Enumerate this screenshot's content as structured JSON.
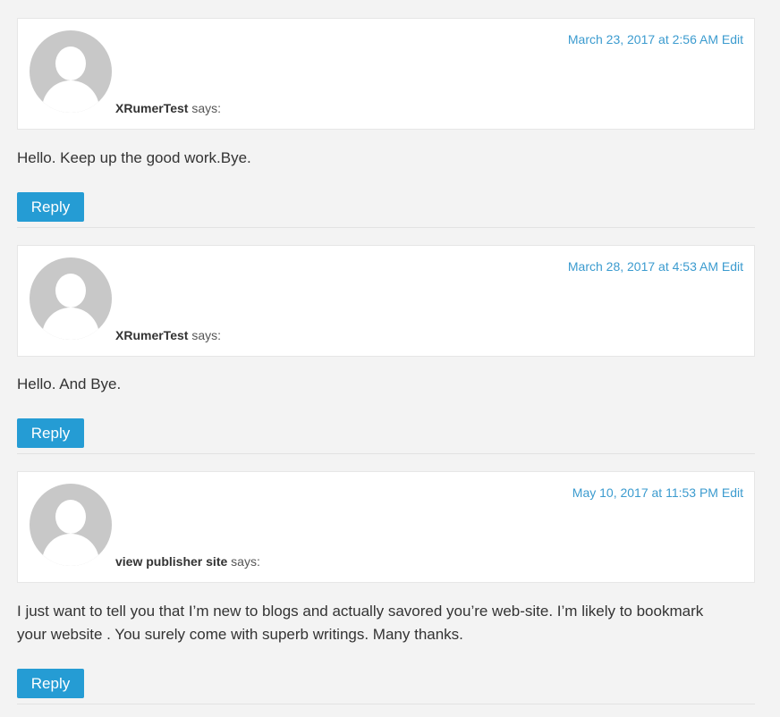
{
  "comments": [
    {
      "date": "March 23, 2017 at 2:56 AM",
      "edit": "Edit",
      "author": "XRumerTest",
      "says": "says:",
      "text": "Hello. Keep up the good work.Bye.",
      "reply": "Reply"
    },
    {
      "date": "March 28, 2017 at 4:53 AM",
      "edit": "Edit",
      "author": "XRumerTest",
      "says": "says:",
      "text": "Hello. And Bye.",
      "reply": "Reply"
    },
    {
      "date": "May 10, 2017 at 11:53 PM",
      "edit": "Edit",
      "author": "view publisher site",
      "says": "says:",
      "text": "I just want to tell you that I’m new to blogs and actually savored you’re web-site. I’m likely to bookmark your website . You surely come with superb writings. Many thanks.",
      "reply": "Reply"
    }
  ],
  "colors": {
    "accent": "#259cd4",
    "link": "#3b9bcf",
    "background": "#f3f3f3"
  }
}
